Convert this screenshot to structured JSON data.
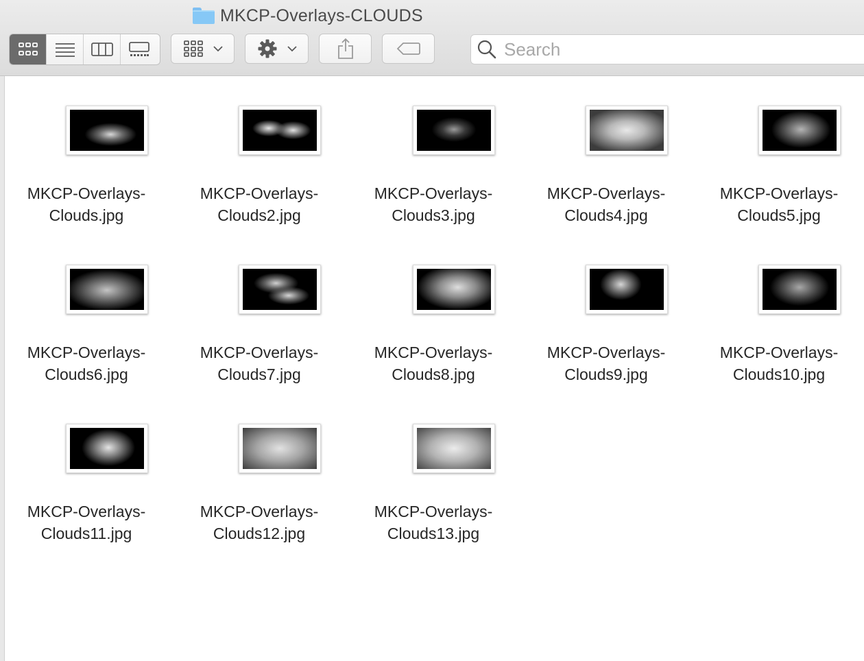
{
  "window": {
    "title": "MKCP-Overlays-CLOUDS"
  },
  "toolbar": {
    "view_modes": [
      "icon-view",
      "list-view",
      "column-view",
      "gallery-view"
    ],
    "active_view": "icon-view",
    "search_placeholder": "Search"
  },
  "files": [
    {
      "line1": "MKCP-Overlays-",
      "line2": "Clouds.jpg",
      "thumb": "radial-gradient(ellipse 35% 28% at 55% 60%, #d8d8d8 0%, #6a6a6a 45%, rgba(0,0,0,0) 100%), #000"
    },
    {
      "line1": "MKCP-Overlays-",
      "line2": "Clouds2.jpg",
      "thumb": "radial-gradient(ellipse 22% 20% at 35% 45%, #e6e6e6 0%, #777 50%, rgba(0,0,0,0) 100%), radial-gradient(ellipse 24% 22% at 68% 50%, #e2e2e2 0%, #707070 50%, rgba(0,0,0,0) 100%), #000"
    },
    {
      "line1": "MKCP-Overlays-",
      "line2": "Clouds3.jpg",
      "thumb": "radial-gradient(ellipse 30% 30% at 50% 48%, #9a9a9a 0%, #3a3a3a 50%, rgba(0,0,0,0) 100%), #000"
    },
    {
      "line1": "MKCP-Overlays-",
      "line2": "Clouds4.jpg",
      "thumb": "radial-gradient(ellipse 60% 55% at 50% 50%, #e8e8e8 0%, #b8b8b8 40%, #3c3c3c 100%), #000"
    },
    {
      "line1": "MKCP-Overlays-",
      "line2": "Clouds5.jpg",
      "thumb": "radial-gradient(ellipse 40% 45% at 52% 48%, #b4b4b4 0%, #5a5a5a 50%, rgba(0,0,0,0) 100%), #000"
    },
    {
      "line1": "MKCP-Overlays-",
      "line2": "Clouds6.jpg",
      "thumb": "radial-gradient(ellipse 55% 50% at 50% 52%, #c4c4c4 0%, #5a5a5a 55%, rgba(0,0,0,0) 100%), #000"
    },
    {
      "line1": "MKCP-Overlays-",
      "line2": "Clouds7.jpg",
      "thumb": "radial-gradient(ellipse 30% 25% at 45% 35%, #d0d0d0 0%, #606060 50%, rgba(0,0,0,0) 100%), radial-gradient(ellipse 28% 22% at 62% 65%, #d6d6d6 0%, #666 50%, rgba(0,0,0,0) 100%), #000"
    },
    {
      "line1": "MKCP-Overlays-",
      "line2": "Clouds8.jpg",
      "thumb": "radial-gradient(ellipse 55% 55% at 55% 45%, #dedede 0%, #8a8a8a 45%, rgba(0,0,0,0) 100%), #000"
    },
    {
      "line1": "MKCP-Overlays-",
      "line2": "Clouds9.jpg",
      "thumb": "radial-gradient(ellipse 28% 38% at 42% 38%, #d6d6d6 0%, #6a6a6a 50%, rgba(0,0,0,0) 100%), #000"
    },
    {
      "line1": "MKCP-Overlays-",
      "line2": "Clouds10.jpg",
      "thumb": "radial-gradient(ellipse 40% 45% at 50% 45%, #a8a8a8 0%, #4a4a4a 55%, rgba(0,0,0,0) 100%), #000"
    },
    {
      "line1": "MKCP-Overlays-",
      "line2": "Clouds11.jpg",
      "thumb": "radial-gradient(ellipse 36% 45% at 52% 48%, #e4e4e4 0%, #828282 45%, rgba(0,0,0,0) 100%), #000"
    },
    {
      "line1": "MKCP-Overlays-",
      "line2": "Clouds12.jpg",
      "thumb": "radial-gradient(ellipse 70% 70% at 50% 50%, #e2e2e2 0%, #a4a4a4 45%, #3e3e3e 100%), #000"
    },
    {
      "line1": "MKCP-Overlays-",
      "line2": "Clouds13.jpg",
      "thumb": "radial-gradient(ellipse 70% 70% at 50% 50%, #ececec 0%, #b2b2b2 45%, #484848 100%), #000"
    }
  ]
}
